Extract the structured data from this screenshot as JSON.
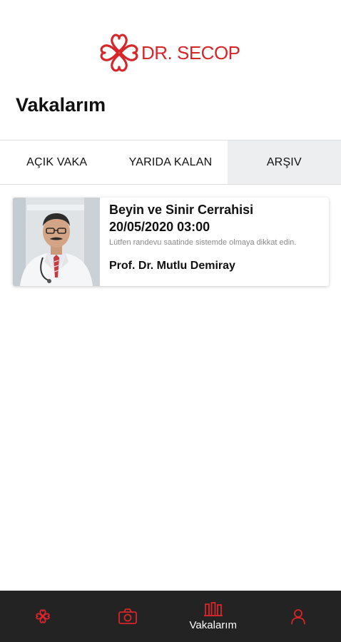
{
  "brand": {
    "logo_text": "DR. SECOP",
    "accent": "#d6262b"
  },
  "page_title": "Vakalarım",
  "tabs": [
    {
      "label": "AÇIK VAKA",
      "active": false
    },
    {
      "label": "YARIDA KALAN",
      "active": false
    },
    {
      "label": "ARŞIV",
      "active": true
    }
  ],
  "cases": [
    {
      "department": "Beyin ve Sinir Cerrahisi",
      "datetime": "20/05/2020 03:00",
      "note": "Lütfen randevu saatinde sistemde olmaya dikkat edin.",
      "doctor": "Prof. Dr. Mutlu Demiray"
    }
  ],
  "bottom_nav": [
    {
      "icon": "clover-logo-icon",
      "label": ""
    },
    {
      "icon": "camera-icon",
      "label": ""
    },
    {
      "icon": "cases-icon",
      "label": "Vakalarım",
      "active": true
    },
    {
      "icon": "profile-icon",
      "label": ""
    }
  ],
  "colors": {
    "nav_bg": "#232323",
    "active_tab_bg": "#eceef0"
  }
}
